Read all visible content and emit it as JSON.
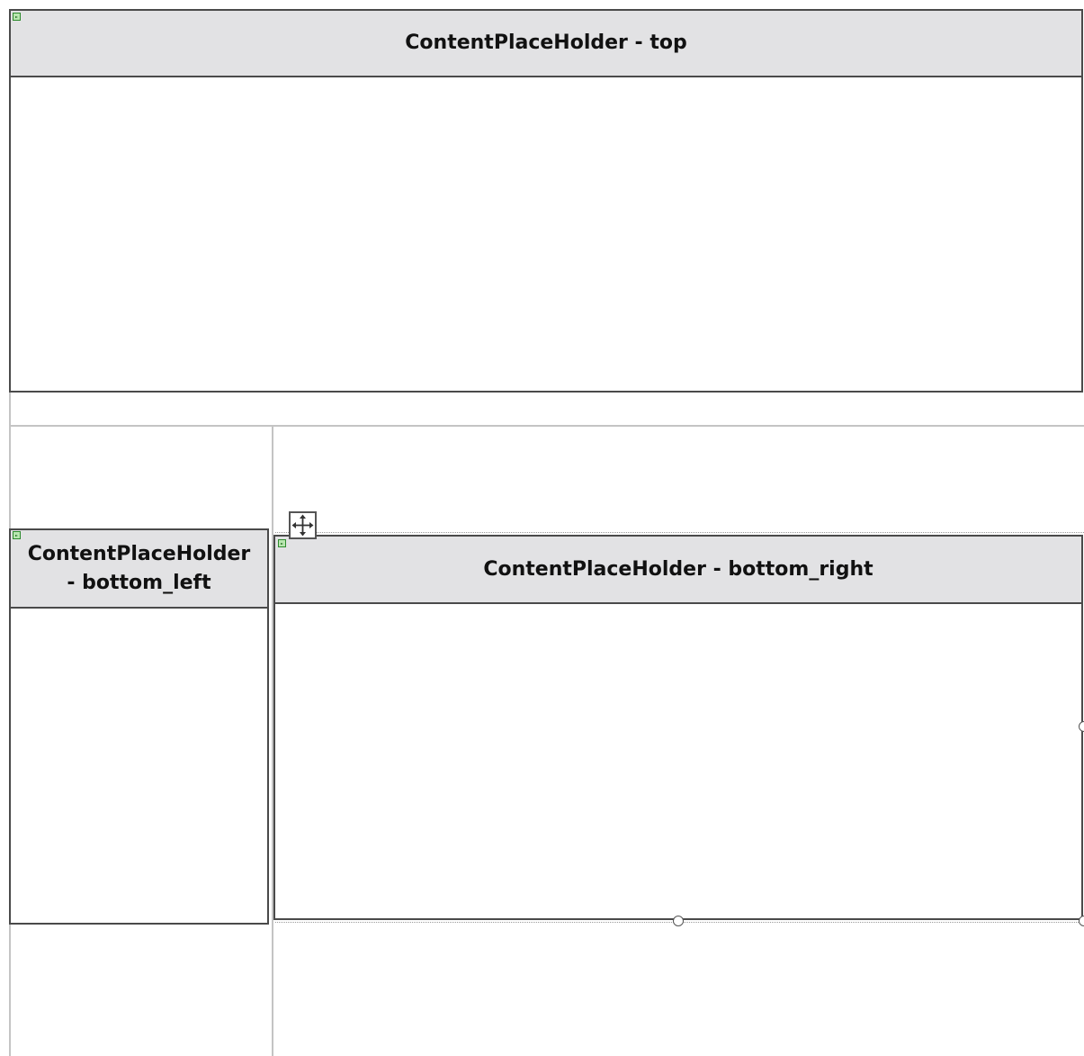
{
  "designer": {
    "placeholders": {
      "top": {
        "title": "ContentPlaceHolder - top"
      },
      "bottom_left": {
        "title_line1": "ContentPlaceHolder",
        "title_line2": "- bottom_left"
      },
      "bottom_right": {
        "title": "ContentPlaceHolder - bottom_right"
      }
    },
    "icons": {
      "smart_tag": "smart-tag-arrow-icon",
      "move": "four-way-move-icon",
      "resize": "resize-handle"
    },
    "colors": {
      "header_bg": "#e2e2e4",
      "border": "#4a4a4a",
      "smart_tag": "#b9e6b0",
      "grid_line": "#c4c4c4"
    }
  }
}
